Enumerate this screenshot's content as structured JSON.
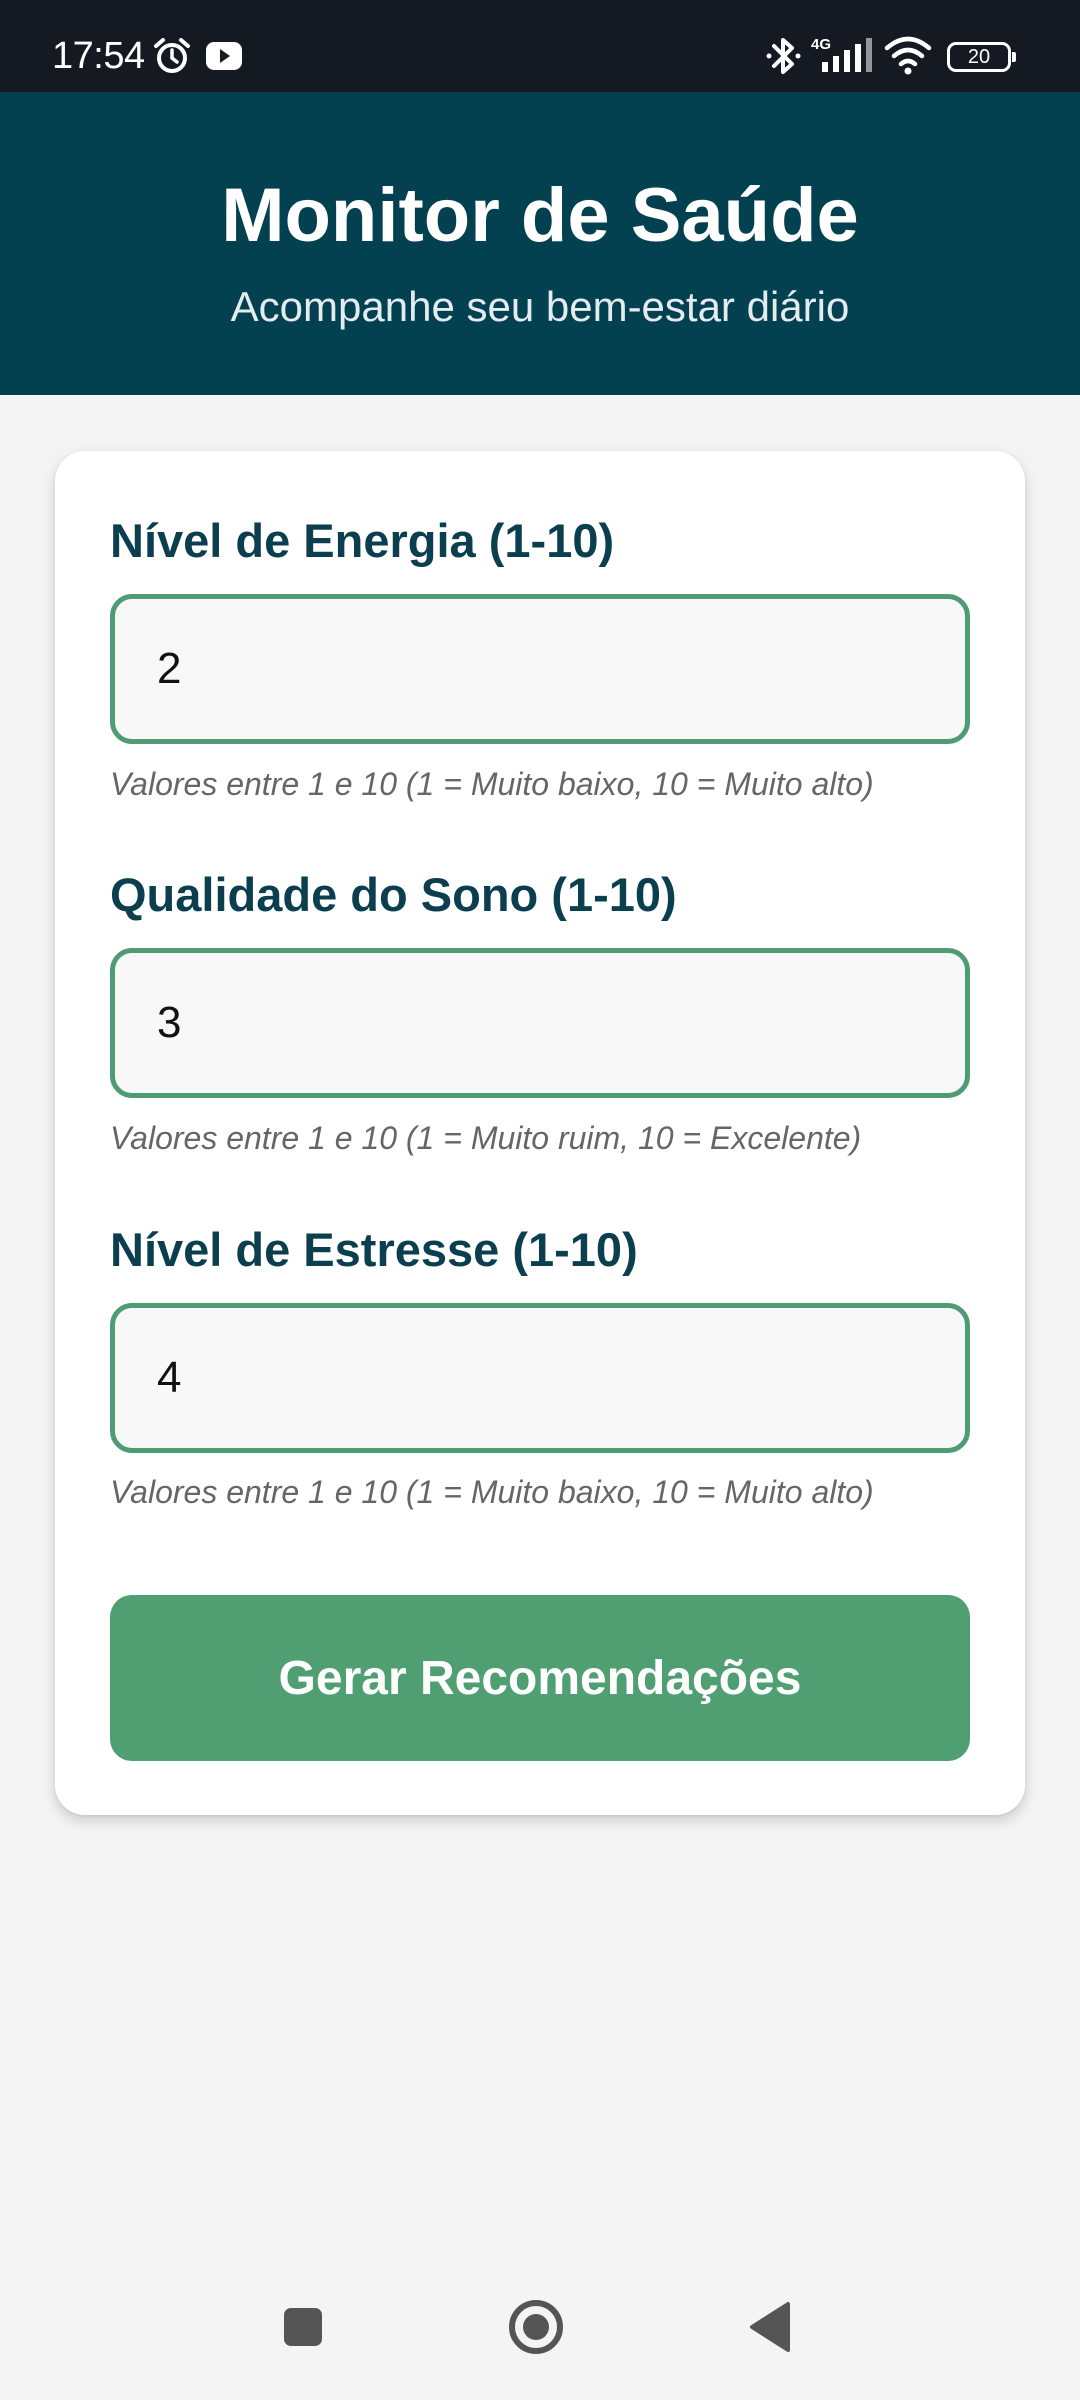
{
  "status_bar": {
    "time": "17:54",
    "icons": [
      "alarm-icon",
      "youtube-icon",
      "bluetooth-icon",
      "signal-4g-icon",
      "wifi-icon",
      "battery-icon"
    ],
    "network_label": "4G",
    "battery_level": "20"
  },
  "header": {
    "title": "Monitor de Saúde",
    "subtitle": "Acompanhe seu bem-estar diário"
  },
  "form": {
    "fields": [
      {
        "label": "Nível de Energia (1-10)",
        "value": "2",
        "hint": "Valores entre 1 e 10 (1 = Muito baixo, 10 = Muito alto)"
      },
      {
        "label": "Qualidade do Sono (1-10)",
        "value": "3",
        "hint": "Valores entre 1 e 10 (1 = Muito ruim, 10 = Excelente)"
      },
      {
        "label": "Nível de Estresse (1-10)",
        "value": "4",
        "hint": "Valores entre 1 e 10 (1 = Muito baixo, 10 = Muito alto)"
      }
    ],
    "submit_label": "Gerar Recomendações"
  },
  "navigation": {
    "buttons": [
      "recents-button",
      "home-button",
      "back-button"
    ]
  },
  "colors": {
    "header_bg": "#034150",
    "accent_green": "#4f9f72",
    "label_text": "#0b3f4f",
    "status_bar_bg": "#151a22",
    "page_bg": "#f4f4f4"
  }
}
